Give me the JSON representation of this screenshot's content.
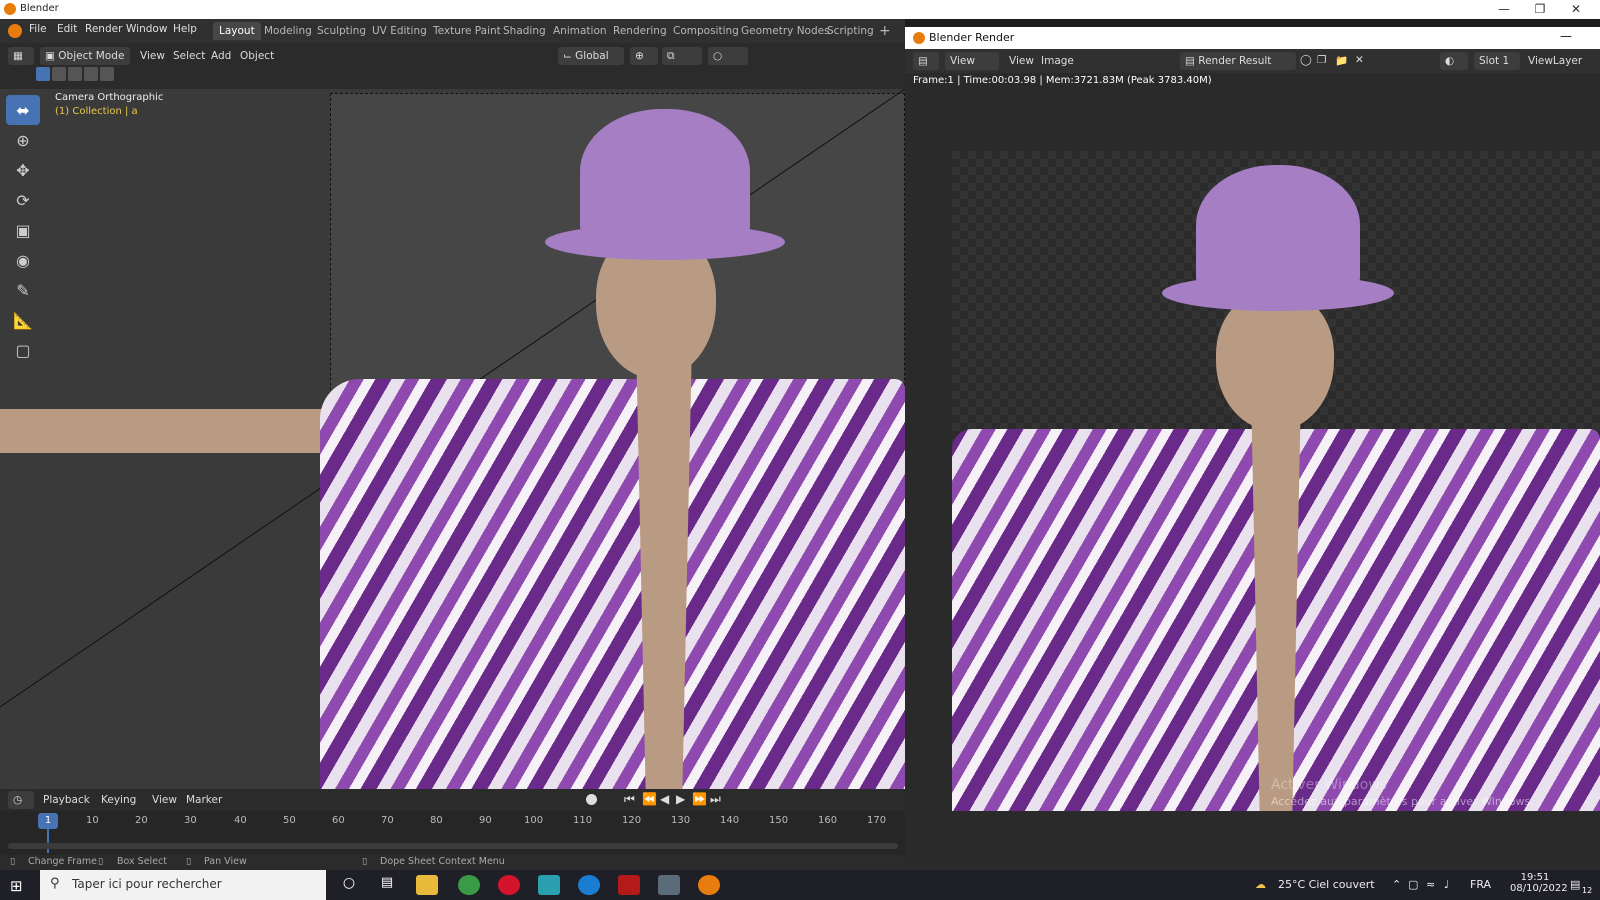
{
  "window": {
    "title": "Blender"
  },
  "menu": [
    "File",
    "Edit",
    "Render",
    "Window",
    "Help"
  ],
  "workspaces": [
    "Layout",
    "Modeling",
    "Sculpting",
    "UV Editing",
    "Texture Paint",
    "Shading",
    "Animation",
    "Rendering",
    "Compositing",
    "Geometry Nodes",
    "Scripting"
  ],
  "active_workspace": "Layout",
  "viewport": {
    "mode": "Object Mode",
    "header_menus": [
      "View",
      "Select",
      "Add",
      "Object"
    ],
    "transform_orientation": "Global",
    "overlay_title": "Camera Orthographic",
    "overlay_collection": "(1) Collection | a"
  },
  "tools": [
    "select-box-icon",
    "cursor-icon",
    "move-icon",
    "rotate-icon",
    "scale-icon",
    "transform-icon",
    "annotate-icon",
    "measure-icon",
    "add-cube-icon"
  ],
  "timeline": {
    "menus": [
      "Playback",
      "Keying",
      "View",
      "Marker"
    ],
    "current_frame": "1",
    "ticks": [
      "10",
      "20",
      "30",
      "40",
      "50",
      "60",
      "70",
      "80",
      "90",
      "100",
      "110",
      "120",
      "130",
      "140",
      "150",
      "160",
      "170"
    ]
  },
  "statusbar": {
    "change_frame": "Change Frame",
    "box_select": "Box Select",
    "pan_view": "Pan View",
    "context_menu": "Dope Sheet Context Menu"
  },
  "render_window": {
    "title": "Blender Render",
    "menus": [
      "View",
      "View",
      "Image"
    ],
    "image_name": "Render Result",
    "slot": "Slot 1",
    "view_layer": "ViewLayer",
    "stats": "Frame:1 | Time:00:03.98 | Mem:3721.83M (Peak 3783.40M)",
    "watermark_title": "Activer Windows",
    "watermark_sub": "Accédez aux paramètres pour activer Windows."
  },
  "taskbar": {
    "search_placeholder": "Taper ici pour rechercher",
    "weather": "25°C  Ciel couvert",
    "lang": "FRA",
    "time": "19:51",
    "date": "08/10/2022",
    "notif_count": "12"
  },
  "colors": {
    "accent": "#4772b3",
    "frame_marker": "#4772b3",
    "shirt": "#7b3a9c",
    "hat": "#a57ec4"
  }
}
